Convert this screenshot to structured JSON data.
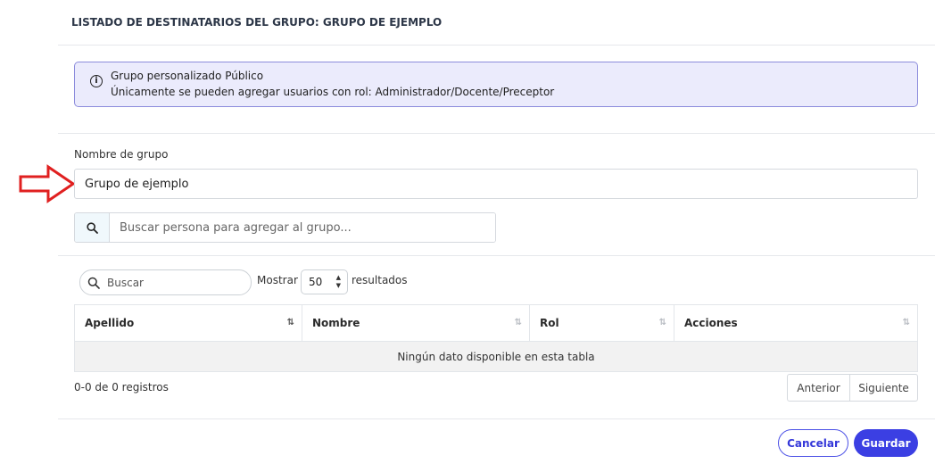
{
  "header": {
    "title": "LISTADO DE DESTINATARIOS DEL GRUPO: GRUPO DE EJEMPLO"
  },
  "alert": {
    "icon": "info-icon",
    "line1": "Grupo personalizado Público",
    "line2": "Únicamente se pueden agregar usuarios con rol: Administrador/Docente/Preceptor"
  },
  "group_name": {
    "label": "Nombre de grupo",
    "value": "Grupo de ejemplo",
    "annotation_arrow_color": "#e02020"
  },
  "person_search": {
    "icon": "search-icon",
    "placeholder": "Buscar persona para agregar al grupo..."
  },
  "table_controls": {
    "search_placeholder": "Buscar",
    "show_label": "Mostrar",
    "page_size": "50",
    "results_label": "resultados"
  },
  "table": {
    "columns": [
      "Apellido",
      "Nombre",
      "Rol",
      "Acciones"
    ],
    "empty_message": "Ningún dato disponible en esta tabla",
    "sort_icon": "⇅"
  },
  "footer": {
    "records_info": "0-0 de 0 registros",
    "prev_label": "Anterior",
    "next_label": "Siguiente"
  },
  "actions": {
    "cancel_label": "Cancelar",
    "save_label": "Guardar"
  },
  "colors": {
    "accent": "#3b3fe3",
    "alert_bg": "#ebebfc",
    "alert_border": "#8c8cdc"
  }
}
